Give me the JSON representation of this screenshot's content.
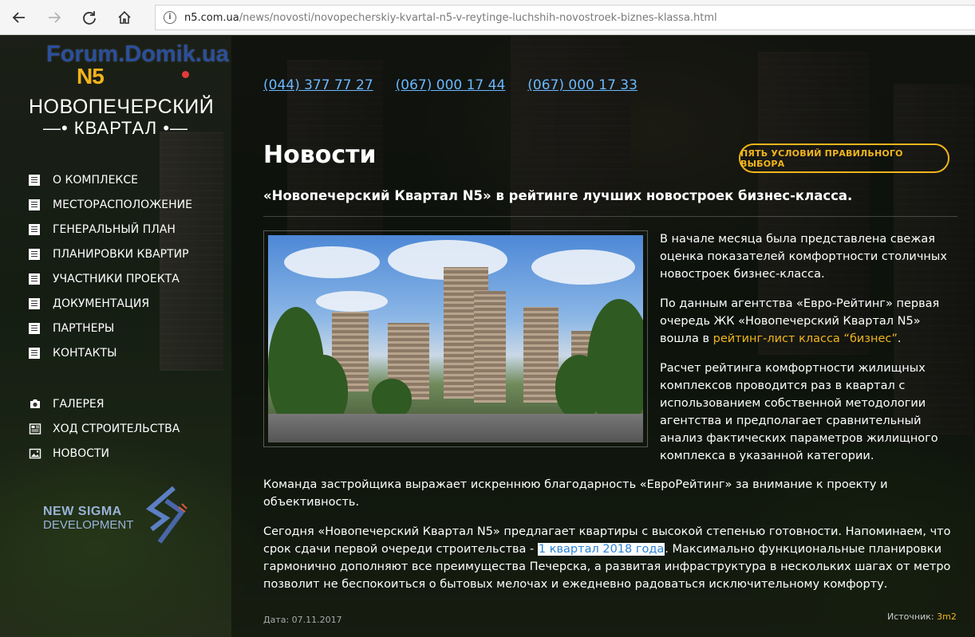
{
  "browser": {
    "url_host": "n5.com.ua",
    "url_path": "/news/novosti/novopecherskiy-kvartal-n5-v-reytinge-luchshih-novostroek-biznes-klassa.html"
  },
  "logo": {
    "watermark": "Forum.Domik.ua",
    "brand_mark": "N5",
    "line1": "НОВОПЕЧЕРСКИЙ",
    "line2": "—• КВАРТАЛ •—"
  },
  "menu": [
    {
      "label": "О КОМПЛЕКСЕ"
    },
    {
      "label": "МЕСТОРАСПОЛОЖЕНИЕ"
    },
    {
      "label": "ГЕНЕРАЛЬНЫЙ ПЛАН"
    },
    {
      "label": "ПЛАНИРОВКИ КВАРТИР"
    },
    {
      "label": "УЧАСТНИКИ ПРОЕКТА"
    },
    {
      "label": "ДОКУМЕНТАЦИЯ"
    },
    {
      "label": "ПАРТНЕРЫ"
    },
    {
      "label": "КОНТАКТЫ"
    }
  ],
  "menu_secondary": [
    {
      "label": "ГАЛЕРЕЯ",
      "icon": "camera-icon"
    },
    {
      "label": "ХОД СТРОИТЕЛЬСТВА",
      "icon": "newspaper-icon"
    },
    {
      "label": "НОВОСТИ",
      "icon": "picture-icon"
    }
  ],
  "developer": {
    "line1": "NEW SIGMA",
    "line2": "DEVELOPMENT"
  },
  "phones": [
    "(044) 377 77 27",
    "(067) 000 17 44",
    "(067) 000 17 33"
  ],
  "page_title": "Новости",
  "cta_label": "ПЯТЬ УСЛОВИЙ ПРАВИЛЬНОГО ВЫБОРА",
  "headline": "«Новопечерский Квартал N5» в рейтинге лучших новостроек бизнес-класса.",
  "article": {
    "p1": "В начале месяца была представлена свежая оценка показателей комфортности столичных новостроек бизнес-класса.",
    "p2_before": "По данным агентства «Евро-Рейтинг» первая очередь ЖК «Новопечерский Квартал N5» вошла в ",
    "p2_link": "рейтинг-лист класса “бизнес”",
    "p2_after": ".",
    "p3": "Расчет рейтинга комфортности жилищных комплексов проводится раз в квартал с использованием собственной методологии агентства и предполагает сравнительный анализ фактических параметров жилищного комплекса в указанной категории.",
    "p4": "Команда застройщика выражает искреннюю благодарность «ЕвроРейтинг» за внимание к проекту и объективность.",
    "p5_before": "Сегодня «Новопечерский Квартал N5» предлагает квартиры с высокой степенью готовности. Напоминаем, что срок сдачи первой очереди строительства - ",
    "p5_highlight": "1 квартал 2018 года",
    "p5_after": ". Максимально функциональные планировки гармонично дополняют все преимущества Печерска, а развитая инфраструктура в нескольких шагах от метро позволит не беспокоиться о бытовых мелочах и ежедневно радоваться исключительному комфорту."
  },
  "date": "Дата: 07.11.2017",
  "source_label": "Источник: ",
  "source_link": "3m2",
  "colors": {
    "accent": "#f1b51c",
    "phone_link": "#69b8ff"
  }
}
